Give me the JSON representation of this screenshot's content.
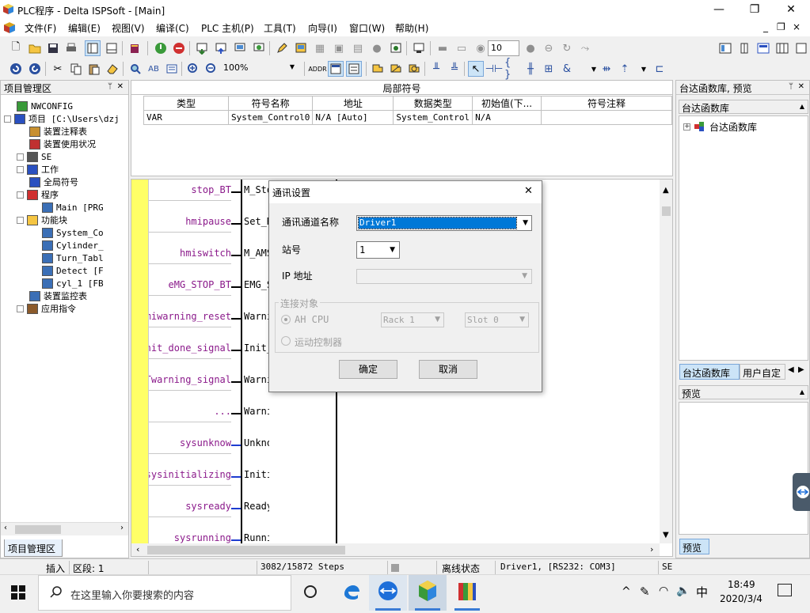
{
  "window": {
    "title": "PLC程序 - Delta ISPSoft - [Main]",
    "minimize": "—",
    "restore": "❐",
    "close": "✕"
  },
  "menu": [
    "文件(F)",
    "编辑(E)",
    "视图(V)",
    "编译(C)",
    "PLC 主机(P)",
    "工具(T)",
    "向导(I)",
    "窗口(W)",
    "帮助(H)"
  ],
  "mdi_buttons": [
    "_",
    "❐",
    "×"
  ],
  "toolbar1": {
    "scan_value": "10"
  },
  "toolbar2": {
    "zoom": "100%"
  },
  "project_panel": {
    "title": "项目管理区",
    "pin": "ᛘ",
    "close": "✕",
    "tab": "项目管理区",
    "tree": [
      {
        "label": "NWCONFIG",
        "depth": 1,
        "expander": "",
        "icon": "network-icon"
      },
      {
        "label": "项目 [C:\\Users\\dzj",
        "depth": 0,
        "expander": "-",
        "icon": "project-icon"
      },
      {
        "label": "装置注释表",
        "depth": 2,
        "expander": "",
        "icon": "table-icon"
      },
      {
        "label": "装置使用状况",
        "depth": 2,
        "expander": "",
        "icon": "status-icon"
      },
      {
        "label": "SE",
        "depth": 1,
        "expander": "+",
        "icon": "se-icon"
      },
      {
        "label": "工作",
        "depth": 1,
        "expander": "+",
        "icon": "task-icon"
      },
      {
        "label": "全局符号",
        "depth": 2,
        "expander": "",
        "icon": "symbol-icon"
      },
      {
        "label": "程序",
        "depth": 1,
        "expander": "-",
        "icon": "program-icon"
      },
      {
        "label": "Main [PRG",
        "depth": 3,
        "expander": "",
        "icon": "pou-icon"
      },
      {
        "label": "功能块",
        "depth": 1,
        "expander": "-",
        "icon": "fb-icon"
      },
      {
        "label": "System_Co",
        "depth": 3,
        "expander": "",
        "icon": "pou-icon"
      },
      {
        "label": "Cylinder_",
        "depth": 3,
        "expander": "",
        "icon": "pou-icon"
      },
      {
        "label": "Turn_Tabl",
        "depth": 3,
        "expander": "",
        "icon": "pou-icon"
      },
      {
        "label": "Detect [F",
        "depth": 3,
        "expander": "",
        "icon": "pou-icon"
      },
      {
        "label": "cyl_1 [FB",
        "depth": 3,
        "expander": "",
        "icon": "pou-icon"
      },
      {
        "label": "装置监控表",
        "depth": 2,
        "expander": "",
        "icon": "monitor-icon"
      },
      {
        "label": "应用指令",
        "depth": 1,
        "expander": "+",
        "icon": "instruction-icon"
      }
    ]
  },
  "local_symbols": {
    "title": "局部符号",
    "headers": [
      "类型",
      "符号名称",
      "地址",
      "数据类型",
      "初始值(下...",
      "符号注释"
    ],
    "rows": [
      [
        "VAR",
        "System_Control0",
        "N/A [Auto]",
        "System_Control",
        "N/A",
        ""
      ]
    ]
  },
  "ladder": {
    "rows": [
      {
        "input": "stop_BT",
        "output": "M_Stop"
      },
      {
        "input": "hmipause",
        "output": "Set_R"
      },
      {
        "input": "hmiswitch",
        "output": "M_AMS"
      },
      {
        "input": "eMG_STOP_BT",
        "output": "EMG_S"
      },
      {
        "input": "hmiwarning_reset",
        "output": "Warnin"
      },
      {
        "input": "hmiinit_done_signal",
        "output": "Init_"
      },
      {
        "input": "hmiTwarning_signal",
        "output": "Warnin"
      },
      {
        "input": "...",
        "output": "Warnin~"
      },
      {
        "input": "sysunknow",
        "output": "Unknow"
      },
      {
        "input": "sysinitializing",
        "output": "Initia~"
      },
      {
        "input": "sysready",
        "output": "Ready"
      },
      {
        "input": "sysrunning",
        "output": "Running"
      }
    ]
  },
  "dialog": {
    "title": "通讯设置",
    "close": "✕",
    "channel_label": "通讯通道名称",
    "channel_value": "Driver1",
    "station_label": "站号",
    "station_value": "1",
    "ip_label": "IP 地址",
    "ip_value": "",
    "group_label": "连接对象",
    "radio_ah": "AH CPU",
    "rack_value": "Rack 1",
    "slot_value": "Slot 0",
    "radio_motion": "运动控制器",
    "ok": "确定",
    "cancel": "取消"
  },
  "right_panel": {
    "title": "台达函数库, 预览",
    "pin": "ᛘ",
    "close": "✕",
    "lib_header": "台达函数库",
    "lib_item": "台达函数库",
    "tab1": "台达函数库",
    "tab2": "用户自定",
    "preview_header": "预览",
    "preview_tab": "预览"
  },
  "statusbar": {
    "mode": "插入",
    "segment": "区段: 1",
    "steps": "3082/15872 Steps",
    "state": "离线状态",
    "connection": "Driver1, [RS232: COM3]",
    "se": "SE"
  },
  "taskbar": {
    "search_placeholder": "在这里输入你要搜索的内容",
    "ime": "中",
    "time": "18:49",
    "date": "2020/3/4"
  },
  "colors": {
    "accent": "#0078d7",
    "ladder_label": "#8b1a8b",
    "rail_yellow": "#ffff66",
    "selection": "#0078d7"
  }
}
